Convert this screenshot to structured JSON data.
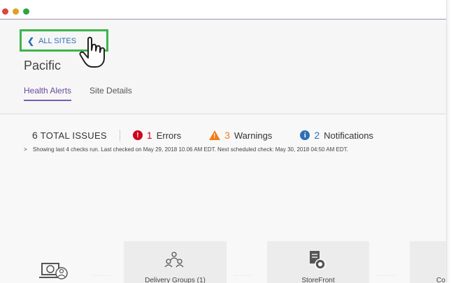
{
  "window": {
    "dots": [
      "close",
      "minimize",
      "maximize"
    ]
  },
  "header": {
    "back_label": "ALL SITES",
    "site_name": "Pacific",
    "tabs": [
      {
        "label": "Health Alerts",
        "active": true
      },
      {
        "label": "Site Details",
        "active": false
      }
    ]
  },
  "summary": {
    "total_count": "6",
    "total_label": "TOTAL ISSUES",
    "errors_count": "1",
    "errors_label": "Errors",
    "warnings_count": "3",
    "warnings_label": "Warnings",
    "notifications_count": "2",
    "notifications_label": "Notifications",
    "check_status": "Showing last 4 checks run. Last checked on May 29, 2018 10.06 AM EDT. Next scheduled check: May 30, 2018 04:50 AM EDT."
  },
  "flow": {
    "nodes": [
      {
        "label": "",
        "icon": "user-laptop-icon"
      },
      {
        "label": "Delivery Groups (1)",
        "icon": "delivery-groups-icon"
      },
      {
        "label": "StoreFront",
        "icon": "storefront-icon"
      },
      {
        "label": "Co",
        "icon": ""
      }
    ]
  },
  "colors": {
    "accent_purple": "#7b5bb0",
    "link_blue": "#2e6fb5",
    "error_red": "#d0021b",
    "warning_orange": "#f07f1a",
    "highlight_green": "#3cb54a"
  }
}
